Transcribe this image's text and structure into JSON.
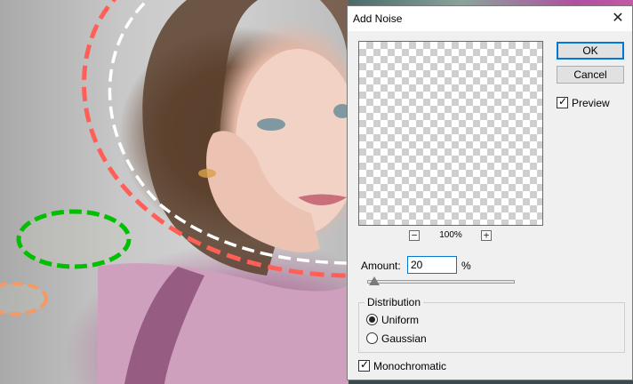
{
  "dialog": {
    "title": "Add Noise",
    "close_glyph": "✕",
    "ok_label": "OK",
    "cancel_label": "Cancel",
    "preview_label": "Preview",
    "preview_checked": true,
    "zoom_out_glyph": "−",
    "zoom_in_glyph": "+",
    "zoom_level": "100%",
    "amount_label": "Amount:",
    "amount_value": "20",
    "amount_unit": "%",
    "amount_slider_percent": 5,
    "distribution_label": "Distribution",
    "distribution_options": [
      "Uniform",
      "Gaussian"
    ],
    "distribution_selected": "Uniform",
    "monochromatic_label": "Monochromatic",
    "monochromatic_checked": true
  },
  "annotations": {
    "colors": {
      "red": "#ff5f57",
      "white": "#ffffff",
      "green": "#00c000",
      "orange": "#f59a62"
    }
  },
  "icons": [
    "close-icon",
    "zoom-out-icon",
    "zoom-in-icon",
    "check-icon",
    "radio-dot-icon"
  ]
}
